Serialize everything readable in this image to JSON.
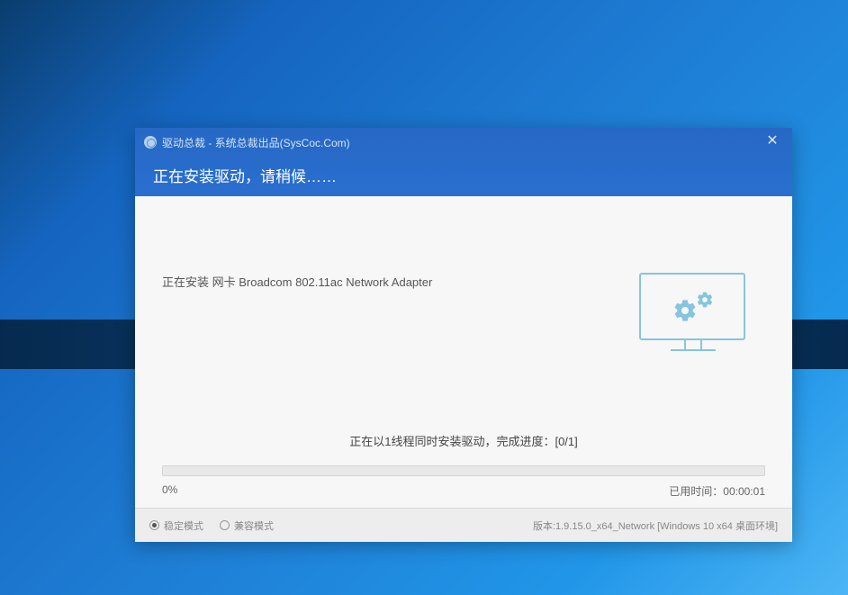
{
  "window": {
    "title": "驱动总裁 - 系统总裁出品(SysCoc.Com)",
    "close_icon": "✕"
  },
  "header": {
    "main_text": "正在安装驱动，请稍候……"
  },
  "body": {
    "install_status": "正在安装 网卡 Broadcom 802.11ac Network Adapter",
    "thread_progress": "正在以1线程同时安装驱动，完成进度：[0/1]",
    "percent": "0%",
    "elapsed_label": "已用时间：",
    "elapsed_time": "00:00:01"
  },
  "footer": {
    "radio1": "稳定模式",
    "radio2": "兼容模式",
    "version": "版本:1.9.15.0_x64_Network [Windows 10 x64 桌面环境]"
  }
}
